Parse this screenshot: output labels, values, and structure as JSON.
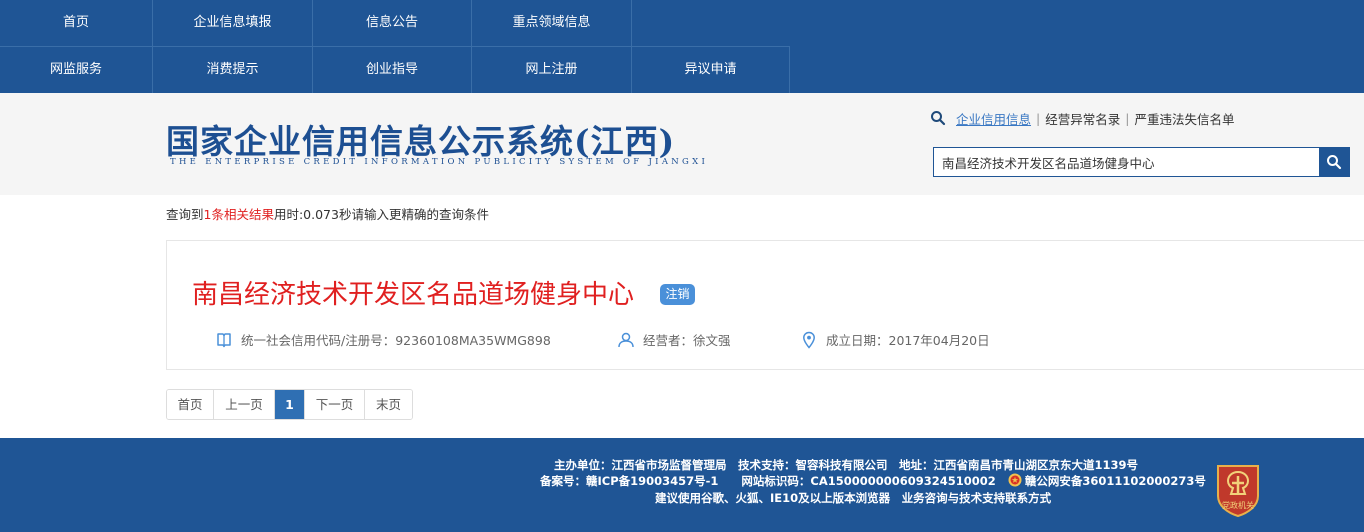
{
  "nav": {
    "row1": [
      "首页",
      "企业信息填报",
      "信息公告",
      "重点领域信息"
    ],
    "row2": [
      "网监服务",
      "消费提示",
      "创业指导",
      "网上注册",
      "异议申请"
    ]
  },
  "header": {
    "logo_cn": "国家企业信用信息公示系统(江西)",
    "logo_en": "THE ENTERPRISE CREDIT INFORMATION PUBLICITY SYSTEM OF JIANGXI",
    "quicklinks": [
      "企业信用信息",
      "经营异常名录",
      "严重违法失信名单"
    ],
    "search_value": "南昌经济技术开发区名品道场健身中心"
  },
  "summary": {
    "prefix": "查询到",
    "count": "1条相关结果",
    "suffix": "用时:0.073秒请输入更精确的查询条件"
  },
  "result": {
    "company_name": "南昌经济技术开发区名品道场健身中心",
    "status": "注销",
    "credit_code": "统一社会信用代码/注册号：92360108MA35WMG898",
    "operator": "经营者：徐文强",
    "established": "成立日期：2017年04月20日"
  },
  "pagination": {
    "first": "首页",
    "prev": "上一页",
    "current": "1",
    "next": "下一页",
    "last": "末页"
  },
  "footer": {
    "line1": "主办单位：江西省市场监督管理局　技术支持：智容科技有限公司　地址：江西省南昌市青山湖区京东大道1139号",
    "line2a": "备案号：赣ICP备19003457号-1　　网站标识码：CA150000000609324510002",
    "line2b": "赣公网安备36011102000273号",
    "line3": "建议使用谷歌、火狐、IE10及以上版本浏览器　业务咨询与技术支持联系方式",
    "emblem_text": "党政机关"
  },
  "colors": {
    "brand_blue": "#1f5595",
    "accent_red": "#e02020",
    "badge_blue": "#4a90d9"
  },
  "icons": [
    "search-icon",
    "book-icon",
    "user-icon",
    "location-pin-icon",
    "police-badge-icon",
    "party-emblem-icon"
  ]
}
